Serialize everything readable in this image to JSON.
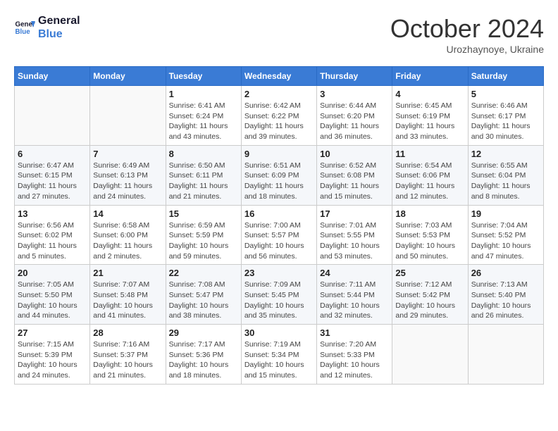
{
  "header": {
    "logo_line1": "General",
    "logo_line2": "Blue",
    "month": "October 2024",
    "location": "Urozhaynoye, Ukraine"
  },
  "weekdays": [
    "Sunday",
    "Monday",
    "Tuesday",
    "Wednesday",
    "Thursday",
    "Friday",
    "Saturday"
  ],
  "weeks": [
    [
      {
        "day": "",
        "info": ""
      },
      {
        "day": "",
        "info": ""
      },
      {
        "day": "1",
        "info": "Sunrise: 6:41 AM\nSunset: 6:24 PM\nDaylight: 11 hours and 43 minutes."
      },
      {
        "day": "2",
        "info": "Sunrise: 6:42 AM\nSunset: 6:22 PM\nDaylight: 11 hours and 39 minutes."
      },
      {
        "day": "3",
        "info": "Sunrise: 6:44 AM\nSunset: 6:20 PM\nDaylight: 11 hours and 36 minutes."
      },
      {
        "day": "4",
        "info": "Sunrise: 6:45 AM\nSunset: 6:19 PM\nDaylight: 11 hours and 33 minutes."
      },
      {
        "day": "5",
        "info": "Sunrise: 6:46 AM\nSunset: 6:17 PM\nDaylight: 11 hours and 30 minutes."
      }
    ],
    [
      {
        "day": "6",
        "info": "Sunrise: 6:47 AM\nSunset: 6:15 PM\nDaylight: 11 hours and 27 minutes."
      },
      {
        "day": "7",
        "info": "Sunrise: 6:49 AM\nSunset: 6:13 PM\nDaylight: 11 hours and 24 minutes."
      },
      {
        "day": "8",
        "info": "Sunrise: 6:50 AM\nSunset: 6:11 PM\nDaylight: 11 hours and 21 minutes."
      },
      {
        "day": "9",
        "info": "Sunrise: 6:51 AM\nSunset: 6:09 PM\nDaylight: 11 hours and 18 minutes."
      },
      {
        "day": "10",
        "info": "Sunrise: 6:52 AM\nSunset: 6:08 PM\nDaylight: 11 hours and 15 minutes."
      },
      {
        "day": "11",
        "info": "Sunrise: 6:54 AM\nSunset: 6:06 PM\nDaylight: 11 hours and 12 minutes."
      },
      {
        "day": "12",
        "info": "Sunrise: 6:55 AM\nSunset: 6:04 PM\nDaylight: 11 hours and 8 minutes."
      }
    ],
    [
      {
        "day": "13",
        "info": "Sunrise: 6:56 AM\nSunset: 6:02 PM\nDaylight: 11 hours and 5 minutes."
      },
      {
        "day": "14",
        "info": "Sunrise: 6:58 AM\nSunset: 6:00 PM\nDaylight: 11 hours and 2 minutes."
      },
      {
        "day": "15",
        "info": "Sunrise: 6:59 AM\nSunset: 5:59 PM\nDaylight: 10 hours and 59 minutes."
      },
      {
        "day": "16",
        "info": "Sunrise: 7:00 AM\nSunset: 5:57 PM\nDaylight: 10 hours and 56 minutes."
      },
      {
        "day": "17",
        "info": "Sunrise: 7:01 AM\nSunset: 5:55 PM\nDaylight: 10 hours and 53 minutes."
      },
      {
        "day": "18",
        "info": "Sunrise: 7:03 AM\nSunset: 5:53 PM\nDaylight: 10 hours and 50 minutes."
      },
      {
        "day": "19",
        "info": "Sunrise: 7:04 AM\nSunset: 5:52 PM\nDaylight: 10 hours and 47 minutes."
      }
    ],
    [
      {
        "day": "20",
        "info": "Sunrise: 7:05 AM\nSunset: 5:50 PM\nDaylight: 10 hours and 44 minutes."
      },
      {
        "day": "21",
        "info": "Sunrise: 7:07 AM\nSunset: 5:48 PM\nDaylight: 10 hours and 41 minutes."
      },
      {
        "day": "22",
        "info": "Sunrise: 7:08 AM\nSunset: 5:47 PM\nDaylight: 10 hours and 38 minutes."
      },
      {
        "day": "23",
        "info": "Sunrise: 7:09 AM\nSunset: 5:45 PM\nDaylight: 10 hours and 35 minutes."
      },
      {
        "day": "24",
        "info": "Sunrise: 7:11 AM\nSunset: 5:44 PM\nDaylight: 10 hours and 32 minutes."
      },
      {
        "day": "25",
        "info": "Sunrise: 7:12 AM\nSunset: 5:42 PM\nDaylight: 10 hours and 29 minutes."
      },
      {
        "day": "26",
        "info": "Sunrise: 7:13 AM\nSunset: 5:40 PM\nDaylight: 10 hours and 26 minutes."
      }
    ],
    [
      {
        "day": "27",
        "info": "Sunrise: 7:15 AM\nSunset: 5:39 PM\nDaylight: 10 hours and 24 minutes."
      },
      {
        "day": "28",
        "info": "Sunrise: 7:16 AM\nSunset: 5:37 PM\nDaylight: 10 hours and 21 minutes."
      },
      {
        "day": "29",
        "info": "Sunrise: 7:17 AM\nSunset: 5:36 PM\nDaylight: 10 hours and 18 minutes."
      },
      {
        "day": "30",
        "info": "Sunrise: 7:19 AM\nSunset: 5:34 PM\nDaylight: 10 hours and 15 minutes."
      },
      {
        "day": "31",
        "info": "Sunrise: 7:20 AM\nSunset: 5:33 PM\nDaylight: 10 hours and 12 minutes."
      },
      {
        "day": "",
        "info": ""
      },
      {
        "day": "",
        "info": ""
      }
    ]
  ]
}
